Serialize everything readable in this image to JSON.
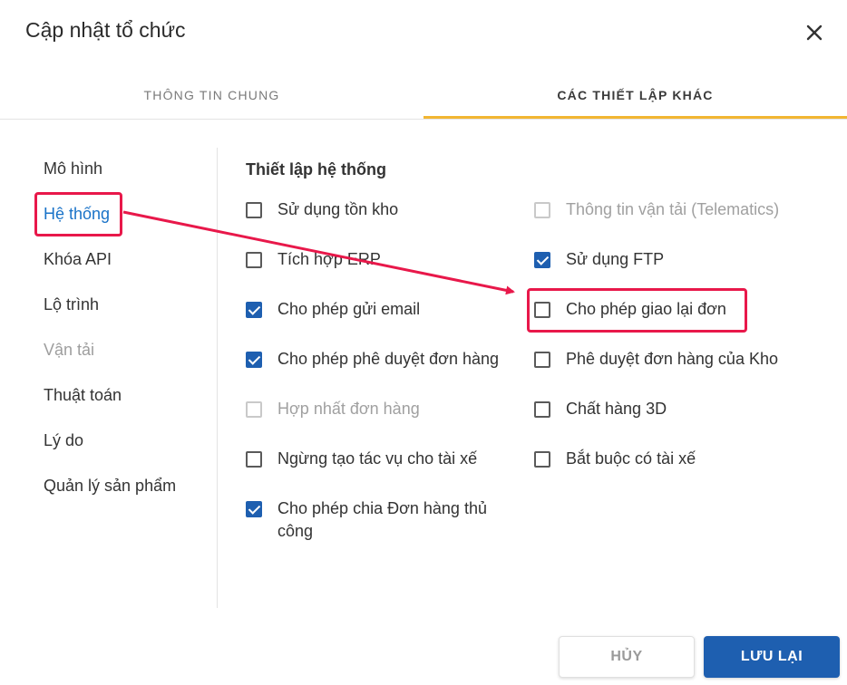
{
  "dialog": {
    "title": "Cập nhật tổ chức",
    "close_icon": "close-icon"
  },
  "tabs": [
    {
      "label": "THÔNG TIN CHUNG",
      "active": false
    },
    {
      "label": "CÁC THIẾT LẬP KHÁC",
      "active": true
    }
  ],
  "sidebar": {
    "items": [
      {
        "label": "Mô hình",
        "state": "normal"
      },
      {
        "label": "Hệ thống",
        "state": "active"
      },
      {
        "label": "Khóa API",
        "state": "normal"
      },
      {
        "label": "Lộ trình",
        "state": "normal"
      },
      {
        "label": "Vận tải",
        "state": "disabled"
      },
      {
        "label": "Thuật toán",
        "state": "normal"
      },
      {
        "label": "Lý do",
        "state": "normal"
      },
      {
        "label": "Quản lý sản phẩm",
        "state": "normal"
      }
    ]
  },
  "settings": {
    "title": "Thiết lập hệ thống",
    "left": [
      {
        "label": "Sử dụng tồn kho",
        "checked": false,
        "disabled": false
      },
      {
        "label": "Tích hợp ERP",
        "checked": false,
        "disabled": false
      },
      {
        "label": "Cho phép gửi email",
        "checked": true,
        "disabled": false
      },
      {
        "label": "Cho phép phê duyệt đơn hàng",
        "checked": true,
        "disabled": false
      },
      {
        "label": "Hợp nhất đơn hàng",
        "checked": false,
        "disabled": true
      },
      {
        "label": "Ngừng tạo tác vụ cho tài xế",
        "checked": false,
        "disabled": false
      },
      {
        "label": "Cho phép chia Đơn hàng thủ công",
        "checked": true,
        "disabled": false
      }
    ],
    "right": [
      {
        "label": "Thông tin vận tải (Telematics)",
        "checked": false,
        "disabled": true
      },
      {
        "label": "Sử dụng FTP",
        "checked": true,
        "disabled": false
      },
      {
        "label": "Cho phép giao lại đơn",
        "checked": false,
        "disabled": false
      },
      {
        "label": "Phê duyệt đơn hàng của Kho",
        "checked": false,
        "disabled": false
      },
      {
        "label": "Chất hàng 3D",
        "checked": false,
        "disabled": false
      },
      {
        "label": "Bắt buộc có tài xế",
        "checked": false,
        "disabled": false
      }
    ]
  },
  "footer": {
    "cancel_label": "HỦY",
    "save_label": "LƯU LẠI"
  },
  "colors": {
    "accent": "#1e5fb0",
    "tab_indicator": "#f2b632",
    "annotation": "#e8184a",
    "active_nav": "#1a73c8"
  }
}
